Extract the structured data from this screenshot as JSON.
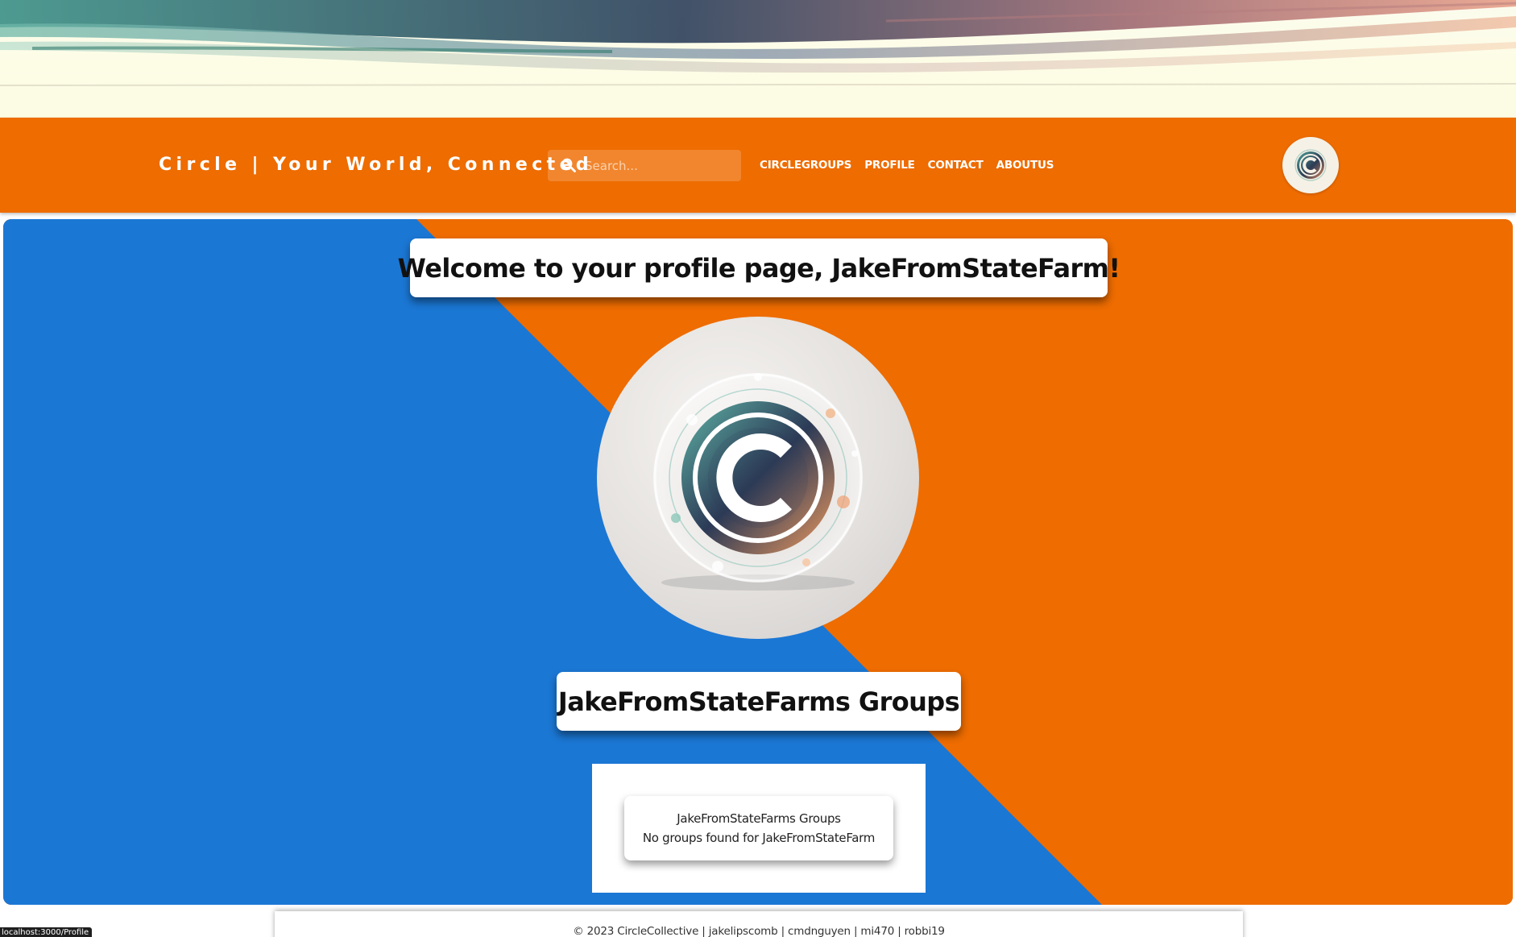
{
  "nav": {
    "brand": "Circle | Your World, Connected",
    "search_placeholder": "Search...",
    "links": [
      "CIRCLEGROUPS",
      "PROFILE",
      "CONTACT",
      "ABOUTUS"
    ],
    "avatar_icon": "circle-logo-icon"
  },
  "main": {
    "welcome": "Welcome to your profile page, JakeFromStateFarm!",
    "profile_image_icon": "circle-logo-icon",
    "groups_heading": "JakeFromStateFarms Groups",
    "groups_card_title": "JakeFromStateFarms Groups",
    "groups_card_message": "No groups found for JakeFromStateFarm"
  },
  "footer": {
    "text": "© 2023 CircleCollective | jakelipscomb | cmdnguyen | mi470 | robbi19"
  },
  "status_bar": {
    "url": "localhost:3000/Profile"
  },
  "colors": {
    "orange": "#ee6c00",
    "blue": "#1b77d4",
    "white": "#ffffff"
  }
}
